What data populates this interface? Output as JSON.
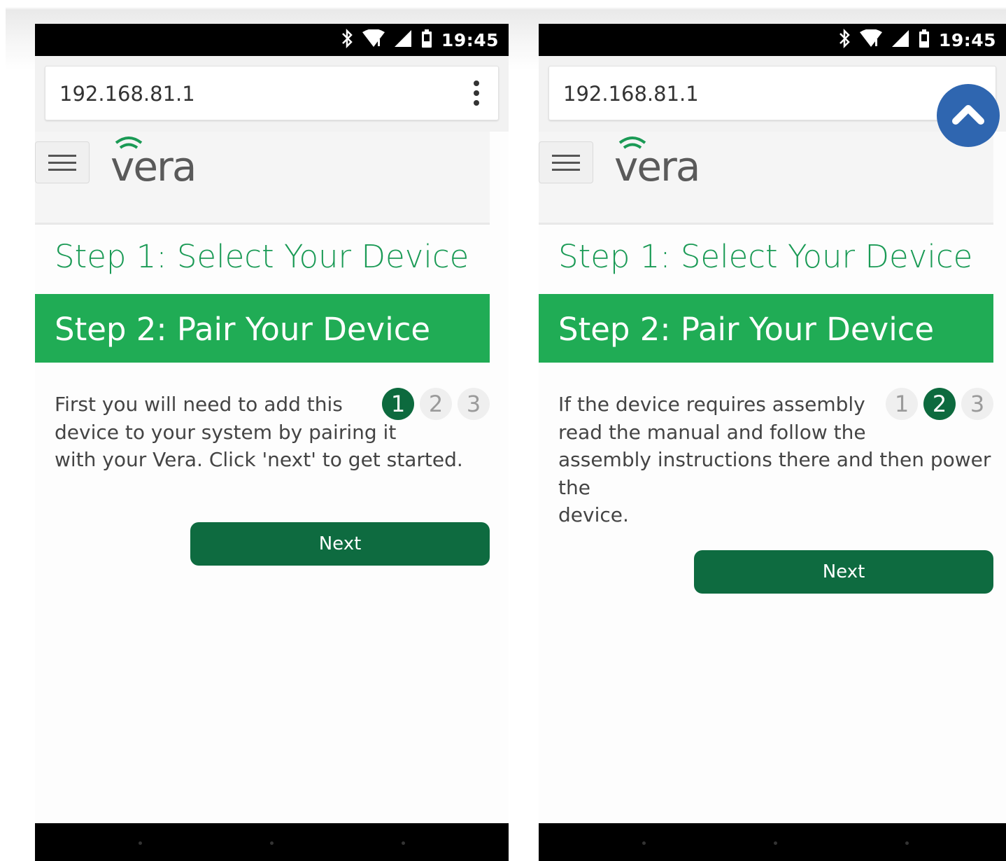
{
  "screens": [
    {
      "status": {
        "time": "19:45"
      },
      "browser": {
        "url": "192.168.81.1"
      },
      "header": {
        "logo": "vera"
      },
      "wizard": {
        "step1": "Step 1: Select Your Device",
        "step2": "Step 2: Pair Your Device",
        "description": "First you will need to add this device to your system by pairing it with your Vera. Click 'next' to get started.",
        "description_lines": [
          "First you will need to add this",
          "device to your system by pairing it",
          "with your Vera. Click 'next' to get started."
        ],
        "pages": [
          "1",
          "2",
          "3"
        ],
        "active_page": "1",
        "next_label": "Next"
      }
    },
    {
      "status": {
        "time": "19:45"
      },
      "browser": {
        "url": "192.168.81.1"
      },
      "header": {
        "logo": "vera"
      },
      "wizard": {
        "step1": "Step 1: Select Your Device",
        "step2": "Step 2: Pair Your Device",
        "description": "If the device requires assembly read the manual and follow the assembly instructions there and then power the device.",
        "description_lines": [
          "If the device requires assembly",
          "read the manual and follow the",
          "assembly instructions there and then power the",
          "device."
        ],
        "pages": [
          "1",
          "2",
          "3"
        ],
        "active_page": "2",
        "next_label": "Next"
      }
    }
  ],
  "overlay": {
    "scroll_to_top_icon": "chevron-up-icon",
    "color": "#2f66b0"
  },
  "colors": {
    "brand_green": "#20ac55",
    "dark_green": "#0e6b40",
    "step_title": "#1a9a55"
  }
}
